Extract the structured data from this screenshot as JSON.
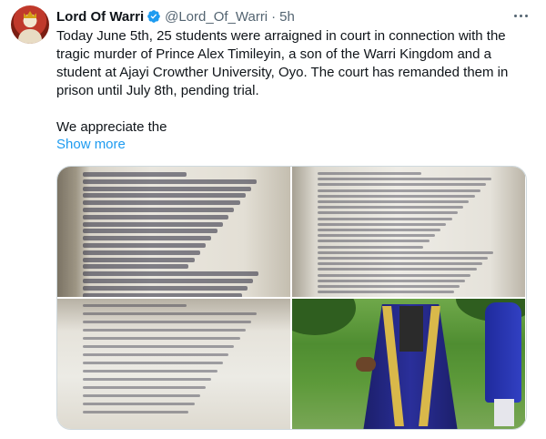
{
  "tweet": {
    "display_name": "Lord Of Warri",
    "handle": "@Lord_Of_Warri",
    "separator": "·",
    "time": "5h",
    "text_paragraph_1": "Today June 5th, 25 students were arraigned in court in connection with the tragic murder of Prince Alex Timileyin, a son of the Warri Kingdom and a student at Ajayi Crowther University, Oyo. The court has remanded them in prison until July 8th, pending trial.",
    "text_paragraph_2": "We appreciate the",
    "show_more": "Show more"
  },
  "icons": {
    "avatar": "avatar-image",
    "verified": "verified-badge-icon",
    "more": "more-options-icon"
  },
  "colors": {
    "link": "#1d9bf0",
    "secondary_text": "#536471",
    "primary_text": "#0f1419",
    "verified": "#1d9bf0"
  },
  "media": {
    "images": [
      {
        "description": "charge sheet page listing accused names and ages"
      },
      {
        "description": "charge sheet count I text"
      },
      {
        "description": "charge sheet count VII and signature"
      },
      {
        "description": "graduate in blue gown with gold stole"
      }
    ]
  }
}
